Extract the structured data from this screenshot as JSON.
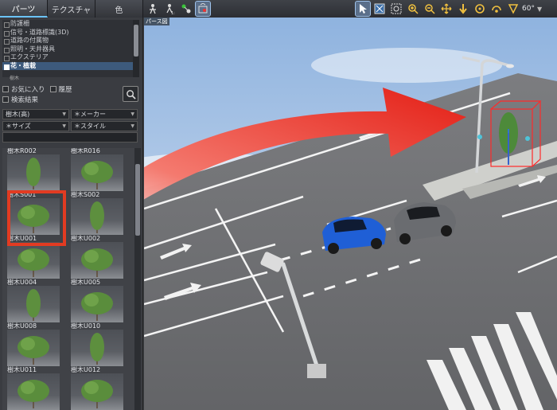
{
  "tabs": [
    {
      "label": "パーツ",
      "active": true
    },
    {
      "label": "テクスチャ",
      "active": false
    },
    {
      "label": "色",
      "active": false
    }
  ],
  "toolbar": {
    "icons": [
      "walk-icon",
      "walk-v2-icon",
      "node-icon",
      "layer-icon",
      "select-arrow-icon",
      "fit-view-icon",
      "zoom-region-icon",
      "zoom-in-icon",
      "zoom-out-icon",
      "pan-icon",
      "move-down-icon",
      "orbit-icon",
      "rotate-icon",
      "fov-icon"
    ],
    "fov_label": "60°"
  },
  "view_tag": "パース図",
  "categories": [
    {
      "label": "防護柵",
      "selected": false
    },
    {
      "label": "信号・道路標識(3D)",
      "selected": false
    },
    {
      "label": "道路の付属物",
      "selected": false
    },
    {
      "label": "照明・天井器具",
      "selected": false
    },
    {
      "label": "エクステリア",
      "selected": false
    },
    {
      "label": "花・植栽",
      "selected": true
    }
  ],
  "sub_item": "樹木",
  "filters": {
    "favorites_label": "お気に入り",
    "history_label": "履歴",
    "search_results_label": "検索結果",
    "dd_tree": "樹木(高)",
    "dd_maker": "＊メーカー",
    "dd_size": "＊サイズ",
    "dd_style": "＊スタイル"
  },
  "thumbnails": [
    {
      "label": "樹木R002"
    },
    {
      "label": "樹木R016"
    },
    {
      "label": "樹木S001"
    },
    {
      "label": "樹木S002"
    },
    {
      "label": "樹木U001"
    },
    {
      "label": "樹木U002"
    },
    {
      "label": "樹木U004"
    },
    {
      "label": "樹木U005"
    },
    {
      "label": "樹木U008"
    },
    {
      "label": "樹木U010"
    },
    {
      "label": "樹木U011"
    },
    {
      "label": "樹木U012"
    }
  ],
  "colors": {
    "arrow": "#e8332a",
    "highlight": "#e23b22",
    "road": "#6e6f72",
    "sky": "#bcd5ef",
    "car_blue": "#1f5fd6",
    "car_gray": "#6a6c70"
  }
}
